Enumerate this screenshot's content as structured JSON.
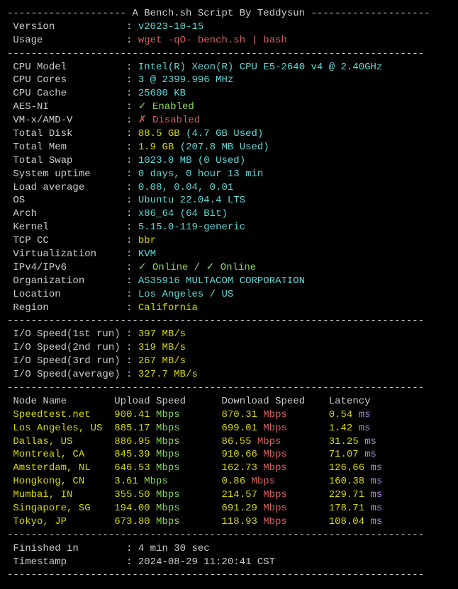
{
  "header": {
    "title": "A Bench.sh Script By Teddysun"
  },
  "info": {
    "version_label": "Version",
    "version_value": "v2023-10-15",
    "usage_label": "Usage",
    "usage_value": "wget -qO- bench.sh | bash"
  },
  "cpu": {
    "model_label": "CPU Model",
    "model_value": "Intel(R) Xeon(R) CPU E5-2640 v4 @ 2.40GHz",
    "cores_label": "CPU Cores",
    "cores_value": "3 @ 2399.996 MHz",
    "cache_label": "CPU Cache",
    "cache_value": "25600 KB",
    "aesni_label": "AES-NI",
    "aesni_value": "✓ Enabled",
    "vmx_label": "VM-x/AMD-V",
    "vmx_value": "✗ Disabled",
    "disk_label": "Total Disk",
    "disk_value": "88.5 GB",
    "disk_used": "(4.7 GB Used)",
    "mem_label": "Total Mem",
    "mem_value": "1.9 GB",
    "mem_used": "(207.8 MB Used)",
    "swap_label": "Total Swap",
    "swap_value": "1023.0 MB",
    "swap_used": "(0 Used)",
    "uptime_label": "System uptime",
    "uptime_value": "0 days, 0 hour 13 min",
    "load_label": "Load average",
    "load_value": "0.08, 0.04, 0.01",
    "os_label": "OS",
    "os_value": "Ubuntu 22.04.4 LTS",
    "arch_label": "Arch",
    "arch_value": "x86_64 (64 Bit)",
    "kernel_label": "Kernel",
    "kernel_value": "5.15.0-119-generic",
    "tcp_label": "TCP CC",
    "tcp_value": "bbr",
    "virt_label": "Virtualization",
    "virt_value": "KVM",
    "ipv_label": "IPv4/IPv6",
    "ipv4_value": "✓ Online",
    "ipv_sep": " / ",
    "ipv6_value": "✓ Online",
    "org_label": "Organization",
    "org_value": "AS35916 MULTACOM CORPORATION",
    "loc_label": "Location",
    "loc_value": "Los Angeles / US",
    "region_label": "Region",
    "region_value": "California"
  },
  "io": {
    "run1_label": "I/O Speed(1st run)",
    "run1_value": "397 MB/s",
    "run2_label": "I/O Speed(2nd run)",
    "run2_value": "319 MB/s",
    "run3_label": "I/O Speed(3rd run)",
    "run3_value": "267 MB/s",
    "avg_label": "I/O Speed(average)",
    "avg_value": "327.7 MB/s"
  },
  "speedtest": {
    "headers": {
      "node": "Node Name",
      "upload": "Upload Speed",
      "download": "Download Speed",
      "latency": "Latency"
    },
    "rows": [
      {
        "node": "Speedtest.net",
        "up_val": "900.41",
        "up_unit": "Mbps",
        "down_val": "870.31",
        "down_unit": "Mbps",
        "lat_val": "0.54",
        "lat_unit": "ms"
      },
      {
        "node": "Los Angeles, US",
        "up_val": "885.17",
        "up_unit": "Mbps",
        "down_val": "699.01",
        "down_unit": "Mbps",
        "lat_val": "1.42",
        "lat_unit": "ms"
      },
      {
        "node": "Dallas, US",
        "up_val": "886.95",
        "up_unit": "Mbps",
        "down_val": "86.55",
        "down_unit": "Mbps",
        "lat_val": "31.25",
        "lat_unit": "ms"
      },
      {
        "node": "Montreal, CA",
        "up_val": "845.39",
        "up_unit": "Mbps",
        "down_val": "910.66",
        "down_unit": "Mbps",
        "lat_val": "71.07",
        "lat_unit": "ms"
      },
      {
        "node": "Amsterdam, NL",
        "up_val": "646.53",
        "up_unit": "Mbps",
        "down_val": "162.73",
        "down_unit": "Mbps",
        "lat_val": "126.66",
        "lat_unit": "ms"
      },
      {
        "node": "Hongkong, CN",
        "up_val": "3.61",
        "up_unit": "Mbps",
        "down_val": "0.86",
        "down_unit": "Mbps",
        "lat_val": "160.38",
        "lat_unit": "ms"
      },
      {
        "node": "Mumbai, IN",
        "up_val": "355.50",
        "up_unit": "Mbps",
        "down_val": "214.57",
        "down_unit": "Mbps",
        "lat_val": "229.71",
        "lat_unit": "ms"
      },
      {
        "node": "Singapore, SG",
        "up_val": "194.00",
        "up_unit": "Mbps",
        "down_val": "691.29",
        "down_unit": "Mbps",
        "lat_val": "178.71",
        "lat_unit": "ms"
      },
      {
        "node": "Tokyo, JP",
        "up_val": "673.80",
        "up_unit": "Mbps",
        "down_val": "118.93",
        "down_unit": "Mbps",
        "lat_val": "108.04",
        "lat_unit": "ms"
      }
    ]
  },
  "footer": {
    "finished_label": "Finished in",
    "finished_value": "4 min 30 sec",
    "timestamp_label": "Timestamp",
    "timestamp_value": "2024-08-29 11:20:41 CST"
  },
  "dashes": {
    "full": "----------------------------------------------------------------------",
    "header_left": "-------------------- ",
    "header_right": " --------------------"
  }
}
